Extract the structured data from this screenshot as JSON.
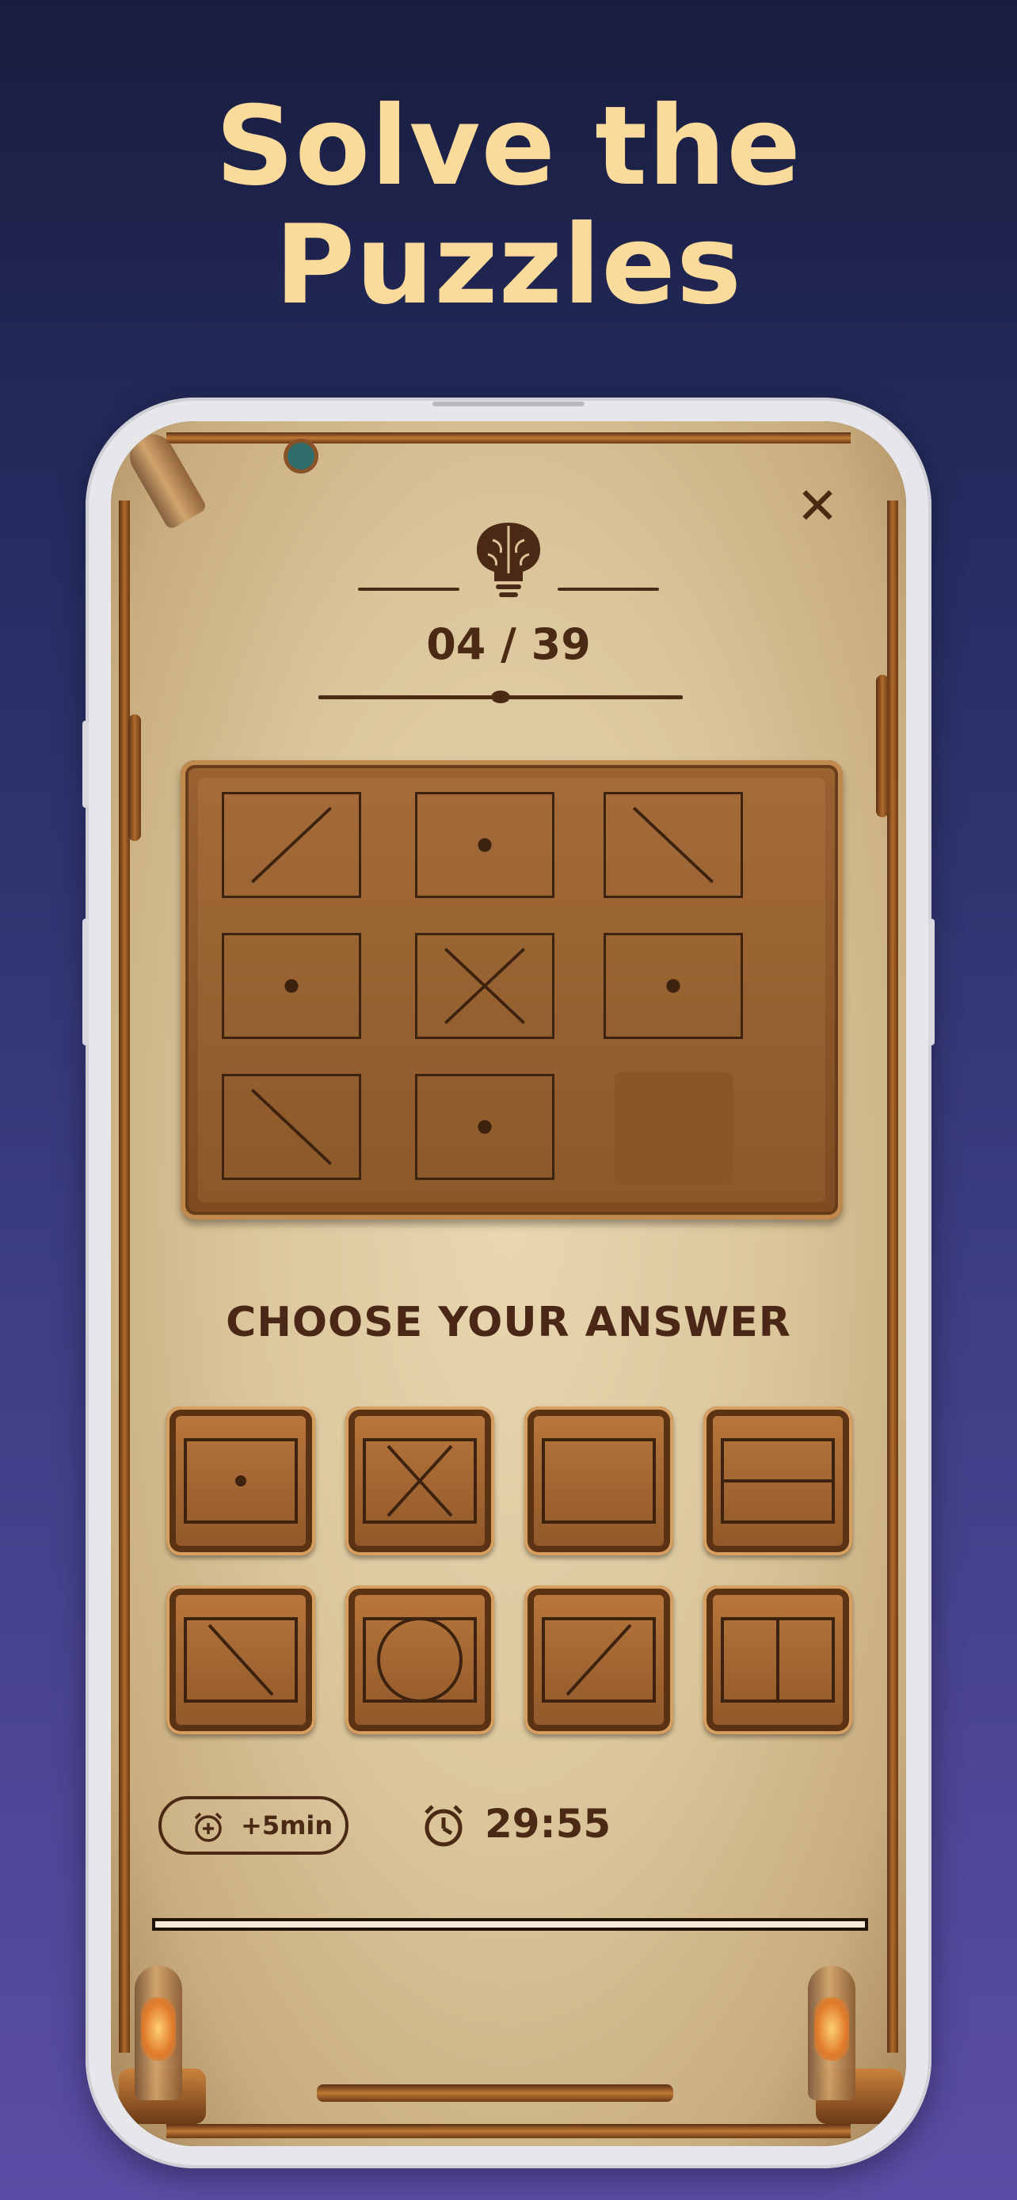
{
  "headline": {
    "line1": "Solve the",
    "line2": "Puzzles"
  },
  "colors": {
    "headline": "#fbdb9b",
    "ink": "#4a2a14",
    "wood": "#8f5628"
  },
  "game": {
    "close_icon": "close-icon",
    "level_icon": "brain-bulb-icon",
    "progress": "04 / 39",
    "puzzle_grid": [
      [
        "diagonal-up",
        "dot",
        "diagonal-down"
      ],
      [
        "dot",
        "cross",
        "dot"
      ],
      [
        "diagonal-down",
        "dot",
        "missing"
      ]
    ],
    "choose_title": "CHOOSE YOUR ANSWER",
    "answers": [
      "dot",
      "cross",
      "empty",
      "horizontal-line",
      "diagonal-down",
      "circle",
      "diagonal-up",
      "vertical-line"
    ],
    "add_time_label": "+5min",
    "add_time_icon": "alarm-plus-icon",
    "timer_icon": "alarm-clock-icon",
    "timer": "29:55",
    "time_remaining_fraction": 1.0
  }
}
